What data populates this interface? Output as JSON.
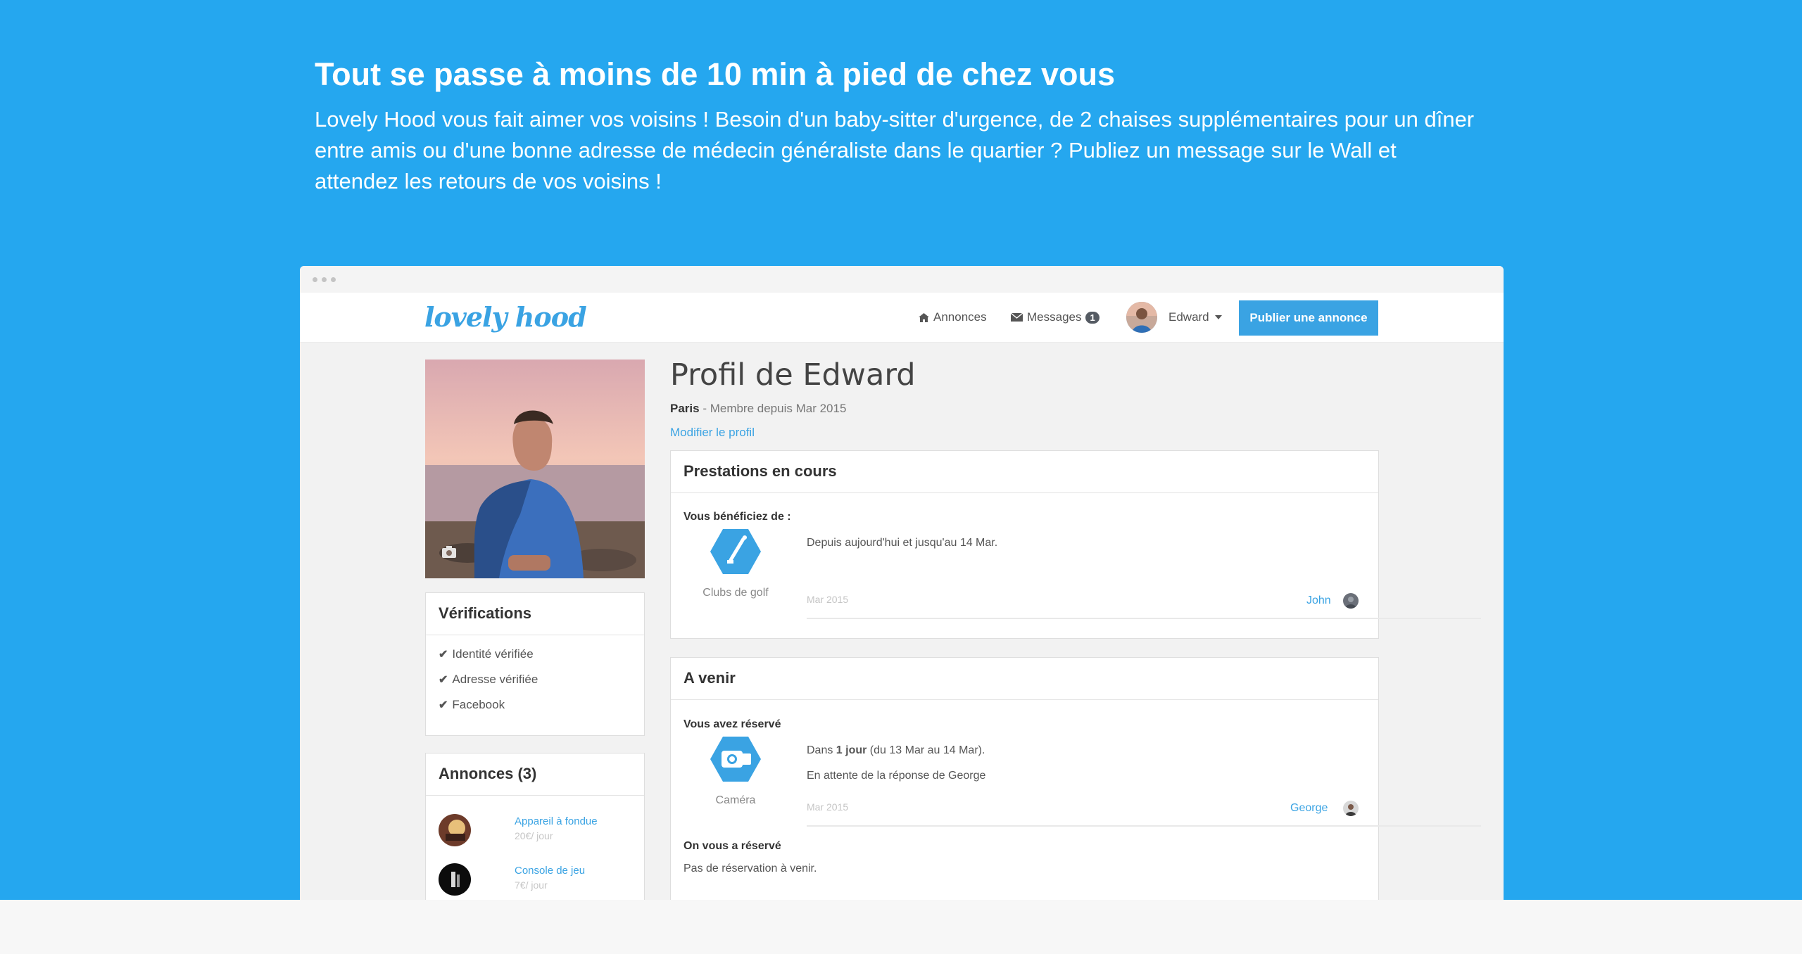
{
  "hero": {
    "title": "Tout se passe à moins de 10 min à pied de chez vous",
    "text": "Lovely Hood vous fait aimer vos voisins ! Besoin d'un baby-sitter d'urgence, de 2 chaises supplémentaires pour un dîner entre amis ou d'une bonne adresse de médecin généraliste dans le quartier ? Publiez un message sur le Wall et attendez les retours de vos voisins !"
  },
  "navbar": {
    "logo": "lovely hood",
    "annonces_label": "Annonces",
    "messages_label": "Messages",
    "messages_count": "1",
    "user_name": "Edward",
    "publish_label": "Publier une annonce"
  },
  "verifications": {
    "title": "Vérifications",
    "items": [
      "Identité vérifiée",
      "Adresse vérifiée",
      "Facebook"
    ]
  },
  "annonces": {
    "title": "Annonces (3)",
    "items": [
      {
        "title": "Appareil à fondue",
        "price": "20€/ jour"
      },
      {
        "title": "Console de jeu",
        "price": "7€/ jour"
      }
    ]
  },
  "profile": {
    "title": "Profil de Edward",
    "city": "Paris",
    "member_since": " - Membre depuis Mar 2015",
    "edit_label": "Modifier le profil"
  },
  "prestations": {
    "title": "Prestations en cours",
    "subtitle": "Vous bénéficiez de :",
    "item_label": "Clubs de golf",
    "item_icon": "golf-club-icon",
    "detail": "Depuis aujourd'hui et jusqu'au 14 Mar.",
    "date": "Mar 2015",
    "user": "John"
  },
  "avenir": {
    "title": "A venir",
    "subtitle": "Vous avez réservé",
    "item_label": "Caméra",
    "item_icon": "camera-icon",
    "detail_prefix": "Dans ",
    "detail_bold": "1 jour",
    "detail_suffix": " (du 13 Mar au 14 Mar).",
    "waiting": "En attente de la réponse de George",
    "date": "Mar 2015",
    "user": "George",
    "received_title": "On vous a réservé",
    "received_text": "Pas de réservation à venir."
  },
  "colors": {
    "hero_bg": "#25a7ef",
    "accent": "#3aa3e3",
    "page_bg": "#f2f2f2"
  }
}
